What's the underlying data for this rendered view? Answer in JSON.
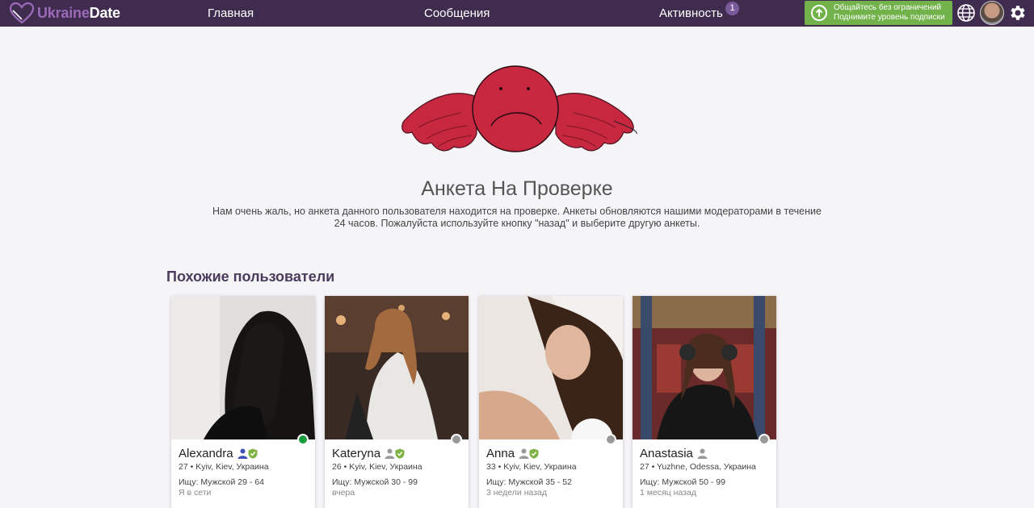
{
  "brand": {
    "part1": "Ukraine",
    "part2": "Date"
  },
  "nav": {
    "home": "Главная",
    "messages": "Сообщения",
    "activity": "Активность",
    "activity_badge": "1"
  },
  "upgrade": {
    "line1": "Общайтесь без ограничений",
    "line2": "Поднимите уровень подписки"
  },
  "colors": {
    "navbar": "#3f2c4f",
    "brand_accent": "#9b6ab9",
    "upgrade_green": "#72b24a",
    "online": "#1a9c3c",
    "offline": "#999999",
    "verified": "#7cb342"
  },
  "hero": {
    "title": "Анкета На Проверке",
    "description": "Нам очень жаль, но анкета данного пользователя находится на проверке. Анкеты обновляются нашими модераторами в течение 24 часов. Пожалуйста используйте кнопку \"назад\" и выберите другую анкеты."
  },
  "similar": {
    "title": "Похожие пользователи",
    "users": [
      {
        "name": "Alexandra",
        "location": "27 • Kyiv, Kiev, Украина",
        "seeking": "Ищу: Мужской 29 - 64",
        "seen": "Я в сети",
        "status": "online",
        "verified": true,
        "icon_color": "#3f51b5"
      },
      {
        "name": "Kateryna",
        "location": "26 • Kyiv, Kiev, Украина",
        "seeking": "Ищу: Мужской 30 - 99",
        "seen": "вчера",
        "status": "offline",
        "verified": true,
        "icon_color": "#999999"
      },
      {
        "name": "Anna",
        "location": "33 • Kyiv, Kiev, Украина",
        "seeking": "Ищу: Мужской 35 - 52",
        "seen": "3 недели назад",
        "status": "offline",
        "verified": true,
        "icon_color": "#999999"
      },
      {
        "name": "Anastasia",
        "location": "27 • Yuzhne, Odessa, Украина",
        "seeking": "Ищу: Мужской 50 - 99",
        "seen": "1 месяц назад",
        "status": "offline",
        "verified": false,
        "icon_color": "#999999"
      }
    ]
  }
}
